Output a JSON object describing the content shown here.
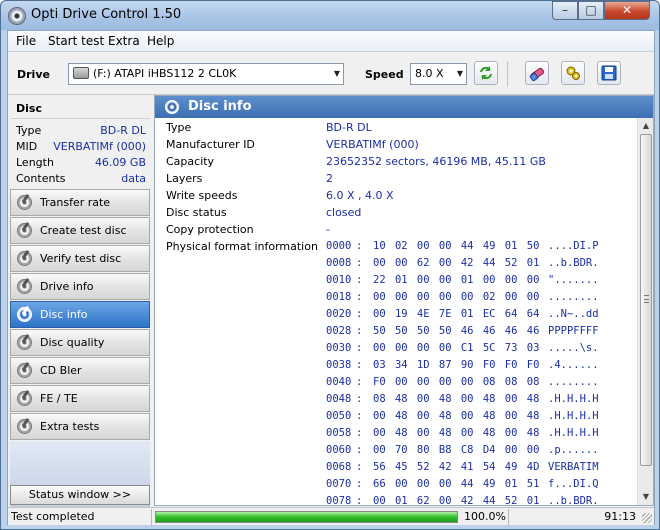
{
  "window": {
    "title": "Opti Drive Control 1.50",
    "min": "–",
    "max": "□",
    "close": "✕"
  },
  "menu": [
    "File",
    "Start test",
    "Extra",
    "Help"
  ],
  "toolbar": {
    "drive_label": "Drive",
    "drive_value": "(F:)   ATAPI iHBS112   2 CL0K",
    "speed_label": "Speed",
    "speed_value": "8.0 X",
    "icons": [
      "refresh-icon",
      "eraser-icon",
      "options-icon",
      "save-icon"
    ]
  },
  "disc": {
    "title": "Disc",
    "rows": [
      {
        "k": "Type",
        "v": "BD-R DL"
      },
      {
        "k": "MID",
        "v": "VERBATIMf (000)"
      },
      {
        "k": "Length",
        "v": "46.09 GB"
      },
      {
        "k": "Contents",
        "v": "data"
      }
    ]
  },
  "nav": [
    {
      "label": "Transfer rate",
      "active": false
    },
    {
      "label": "Create test disc",
      "active": false
    },
    {
      "label": "Verify test disc",
      "active": false
    },
    {
      "label": "Drive info",
      "active": false
    },
    {
      "label": "Disc info",
      "active": true
    },
    {
      "label": "Disc quality",
      "active": false
    },
    {
      "label": "CD Bler",
      "active": false
    },
    {
      "label": "FE / TE",
      "active": false
    },
    {
      "label": "Extra tests",
      "active": false
    }
  ],
  "status_window_button": "Status window >>",
  "panel": {
    "title": "Disc info",
    "fields": [
      {
        "k": "Type",
        "v": "BD-R DL"
      },
      {
        "k": "Manufacturer ID",
        "v": "VERBATIMf (000)"
      },
      {
        "k": "Capacity",
        "v": "23652352 sectors, 46196 MB, 45.11 GB"
      },
      {
        "k": "Layers",
        "v": "2"
      },
      {
        "k": "Write speeds",
        "v": "6.0 X , 4.0 X"
      },
      {
        "k": "Disc status",
        "v": "closed"
      },
      {
        "k": "Copy protection",
        "v": "-"
      },
      {
        "k": "Physical format information",
        "v": ""
      }
    ],
    "hex": [
      {
        "o": "0000",
        "b": "10 02 00 00 44 49 01 50",
        "a": "....DI.P"
      },
      {
        "o": "0008",
        "b": "00 00 62 00 42 44 52 01",
        "a": "..b.BDR."
      },
      {
        "o": "0010",
        "b": "22 01 00 00 01 00 00 00",
        "a": "\"......."
      },
      {
        "o": "0018",
        "b": "00 00 00 00 00 02 00 00",
        "a": "........"
      },
      {
        "o": "0020",
        "b": "00 19 4E 7E 01 EC 64 64",
        "a": "..N~..dd"
      },
      {
        "o": "0028",
        "b": "50 50 50 50 46 46 46 46",
        "a": "PPPPFFFF"
      },
      {
        "o": "0030",
        "b": "00 00 00 00 C1 5C 73 03",
        "a": ".....\\s."
      },
      {
        "o": "0038",
        "b": "03 34 1D 87 90 F0 F0 F0",
        "a": ".4......"
      },
      {
        "o": "0040",
        "b": "F0 00 00 00 00 08 08 08",
        "a": "........"
      },
      {
        "o": "0048",
        "b": "08 48 00 48 00 48 00 48",
        "a": ".H.H.H.H"
      },
      {
        "o": "0050",
        "b": "00 48 00 48 00 48 00 48",
        "a": ".H.H.H.H"
      },
      {
        "o": "0058",
        "b": "00 48 00 48 00 48 00 48",
        "a": ".H.H.H.H"
      },
      {
        "o": "0060",
        "b": "00 70 80 B8 C8 D4 00 00",
        "a": ".p......"
      },
      {
        "o": "0068",
        "b": "56 45 52 42 41 54 49 4D",
        "a": "VERBATIM"
      },
      {
        "o": "0070",
        "b": "66 00 00 00 44 49 01 51",
        "a": "f...DI.Q"
      },
      {
        "o": "0078",
        "b": "00 01 62 00 42 44 52 01",
        "a": "..b.BDR."
      }
    ]
  },
  "status": {
    "text": "Test completed",
    "progress": 1.0,
    "percent": "100.0%",
    "time": "91:13"
  }
}
